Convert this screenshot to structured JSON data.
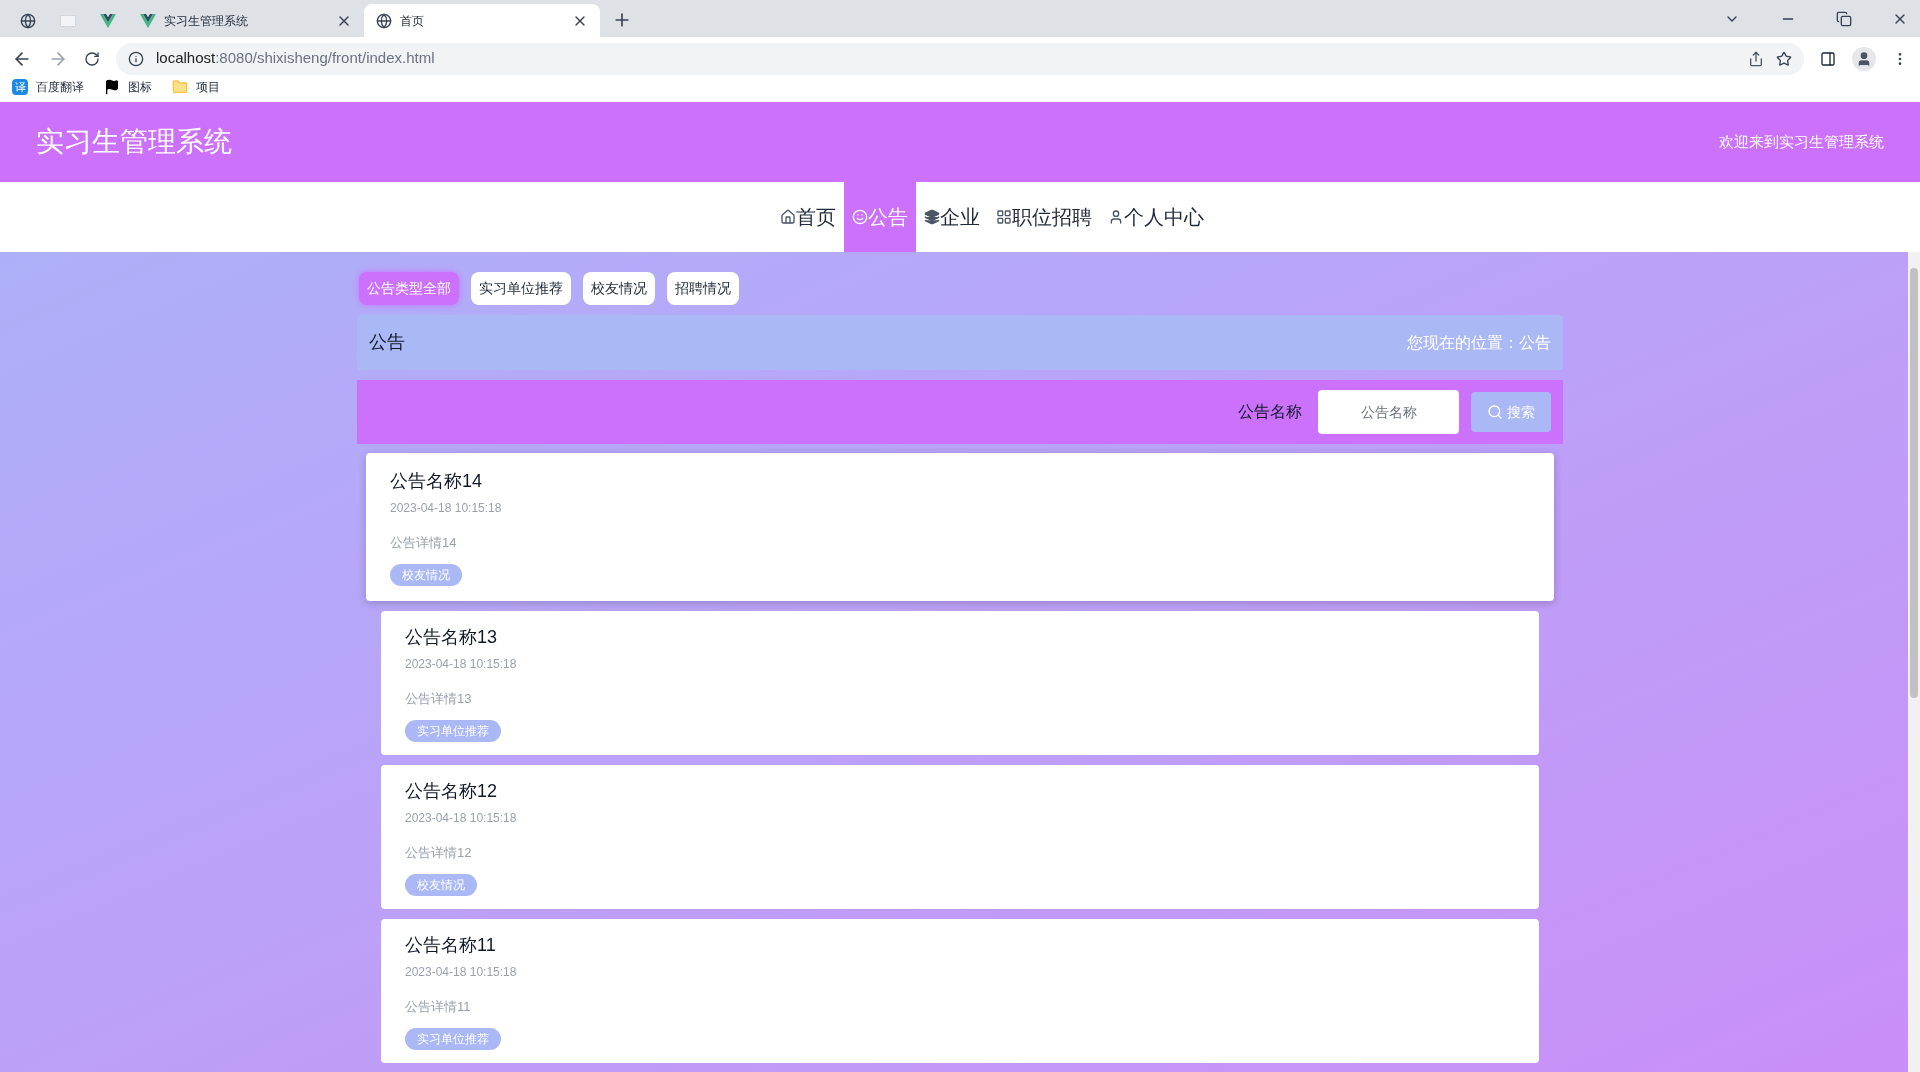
{
  "browser": {
    "tabs": [
      {
        "kind": "globe",
        "selected": false
      },
      {
        "kind": "blank",
        "selected": false
      },
      {
        "kind": "vue",
        "selected": false
      },
      {
        "kind": "vue",
        "title": "实习生管理系统",
        "selected": false
      },
      {
        "kind": "globe",
        "title": "首页",
        "selected": true
      }
    ],
    "url_host": "localhost",
    "url_rest": ":8080/shixisheng/front/index.html",
    "bookmarks": [
      {
        "kind": "translate",
        "label": "百度翻译",
        "glyph": "译"
      },
      {
        "kind": "flag",
        "label": "图标"
      },
      {
        "kind": "folder",
        "label": "项目"
      }
    ]
  },
  "header": {
    "title": "实习生管理系统",
    "welcome": "欢迎来到实习生管理系统"
  },
  "nav": [
    {
      "kind": "home",
      "label": "首页",
      "selected": false
    },
    {
      "kind": "face",
      "label": "公告",
      "selected": true
    },
    {
      "kind": "stack",
      "label": "企业",
      "selected": false
    },
    {
      "kind": "grid",
      "label": "职位招聘",
      "selected": false
    },
    {
      "kind": "user",
      "label": "个人中心",
      "selected": false
    }
  ],
  "filters": [
    {
      "label": "公告类型全部",
      "selected": true
    },
    {
      "label": "实习单位推荐",
      "selected": false
    },
    {
      "label": "校友情况",
      "selected": false
    },
    {
      "label": "招聘情况",
      "selected": false
    }
  ],
  "breadcrumb": {
    "title": "公告",
    "location": "您现在的位置：公告"
  },
  "search": {
    "label": "公告名称",
    "placeholder": "公告名称",
    "button": "搜索"
  },
  "notices": [
    {
      "title": "公告名称14",
      "time": "2023-04-18 10:15:18",
      "detail": "公告详情14",
      "tag": "校友情况",
      "hovered": true
    },
    {
      "title": "公告名称13",
      "time": "2023-04-18 10:15:18",
      "detail": "公告详情13",
      "tag": "实习单位推荐",
      "hovered": false
    },
    {
      "title": "公告名称12",
      "time": "2023-04-18 10:15:18",
      "detail": "公告详情12",
      "tag": "校友情况",
      "hovered": false
    },
    {
      "title": "公告名称11",
      "time": "2023-04-18 10:15:18",
      "detail": "公告详情11",
      "tag": "实习单位推荐",
      "hovered": false
    }
  ]
}
